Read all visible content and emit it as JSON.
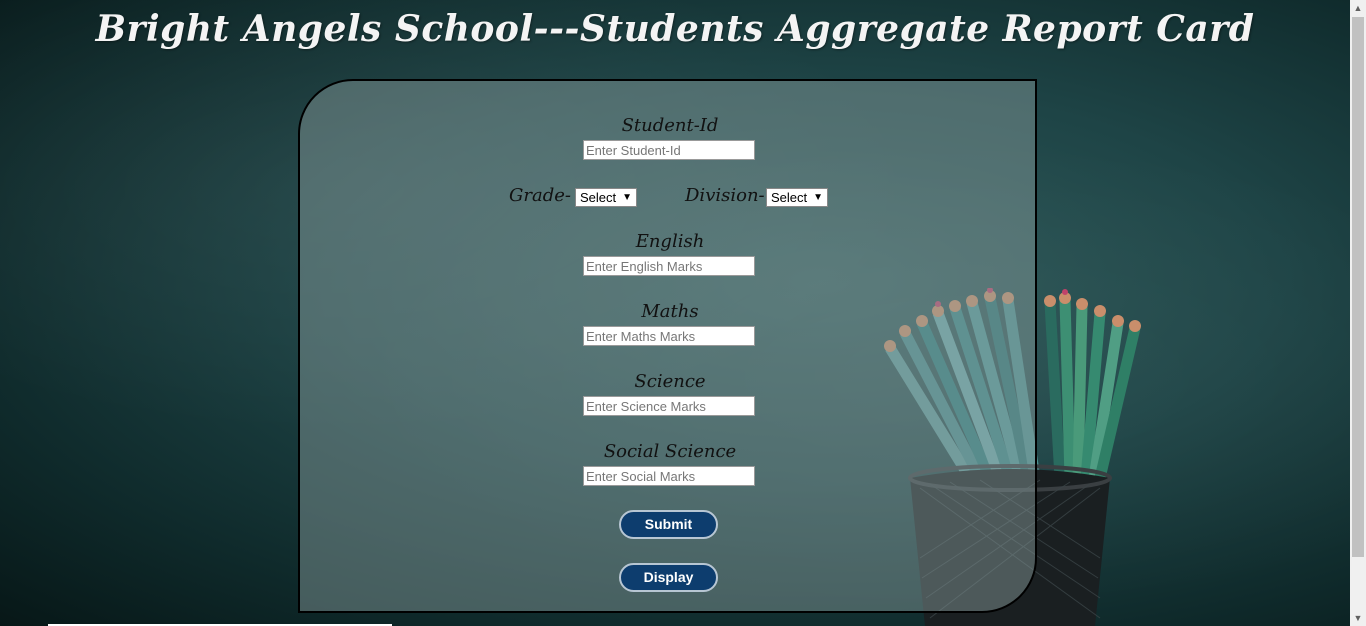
{
  "title": "Bright Angels School---Students Aggregate Report Card",
  "form": {
    "student_id": {
      "label": "Student-Id",
      "placeholder": "Enter Student-Id",
      "value": ""
    },
    "grade": {
      "label": "Grade-",
      "selected": "Select"
    },
    "division": {
      "label": "Division-",
      "selected": "Select"
    },
    "english": {
      "label": "English",
      "placeholder": "Enter English Marks",
      "value": ""
    },
    "maths": {
      "label": "Maths",
      "placeholder": "Enter Maths Marks",
      "value": ""
    },
    "science": {
      "label": "Science",
      "placeholder": "Enter Science Marks",
      "value": ""
    },
    "social": {
      "label": "Social Science",
      "placeholder": "Enter Social Marks",
      "value": ""
    }
  },
  "buttons": {
    "submit": "Submit",
    "display": "Display"
  },
  "colors": {
    "button_bg": "#0d3d6e",
    "title": "#f4f4f4",
    "background": "#1e4446"
  },
  "icons": {
    "dropdown": "chevron-down-icon",
    "scroll_up": "arrow-up-icon",
    "scroll_down": "arrow-down-icon"
  }
}
